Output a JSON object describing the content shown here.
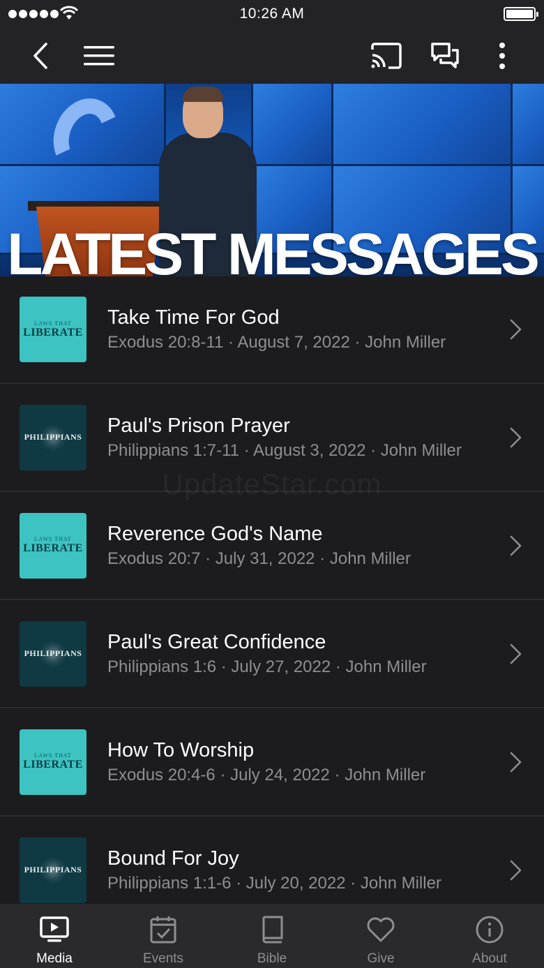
{
  "status_bar": {
    "time": "10:26 AM"
  },
  "hero": {
    "title": "LATEST MESSAGES"
  },
  "messages": [
    {
      "title": "Take Time For God",
      "subtitle": "Exodus 20:8-11 · August 7, 2022 · John Miller",
      "thumb": "liberate"
    },
    {
      "title": "Paul's Prison Prayer",
      "subtitle": "Philippians 1:7-11 · August 3, 2022 · John Miller",
      "thumb": "philippians"
    },
    {
      "title": "Reverence God's Name",
      "subtitle": "Exodus 20:7 · July 31, 2022 · John Miller",
      "thumb": "liberate"
    },
    {
      "title": "Paul's Great Confidence",
      "subtitle": "Philippians 1:6 · July 27, 2022 · John Miller",
      "thumb": "philippians"
    },
    {
      "title": "How To Worship",
      "subtitle": "Exodus 20:4-6 · July 24, 2022 · John Miller",
      "thumb": "liberate"
    },
    {
      "title": "Bound For Joy",
      "subtitle": "Philippians 1:1-6 · July 20, 2022 · John Miller",
      "thumb": "philippians"
    }
  ],
  "thumbs": {
    "liberate": {
      "small": "LAWS THAT",
      "big": "LIBERATE",
      "color": "#3cc3c2"
    },
    "philippians": {
      "big": "PHILIPPIANS",
      "color": "#0f3943"
    }
  },
  "watermark": "UpdateStar.com",
  "tabs": [
    {
      "label": "Media",
      "icon": "media-icon",
      "active": true
    },
    {
      "label": "Events",
      "icon": "calendar-icon",
      "active": false
    },
    {
      "label": "Bible",
      "icon": "book-icon",
      "active": false
    },
    {
      "label": "Give",
      "icon": "heart-icon",
      "active": false
    },
    {
      "label": "About",
      "icon": "info-icon",
      "active": false
    }
  ],
  "colors": {
    "background": "#1c1c1e",
    "bar": "#232325",
    "accent_teal": "#3cc3c2",
    "muted_text": "#8e8e93"
  }
}
